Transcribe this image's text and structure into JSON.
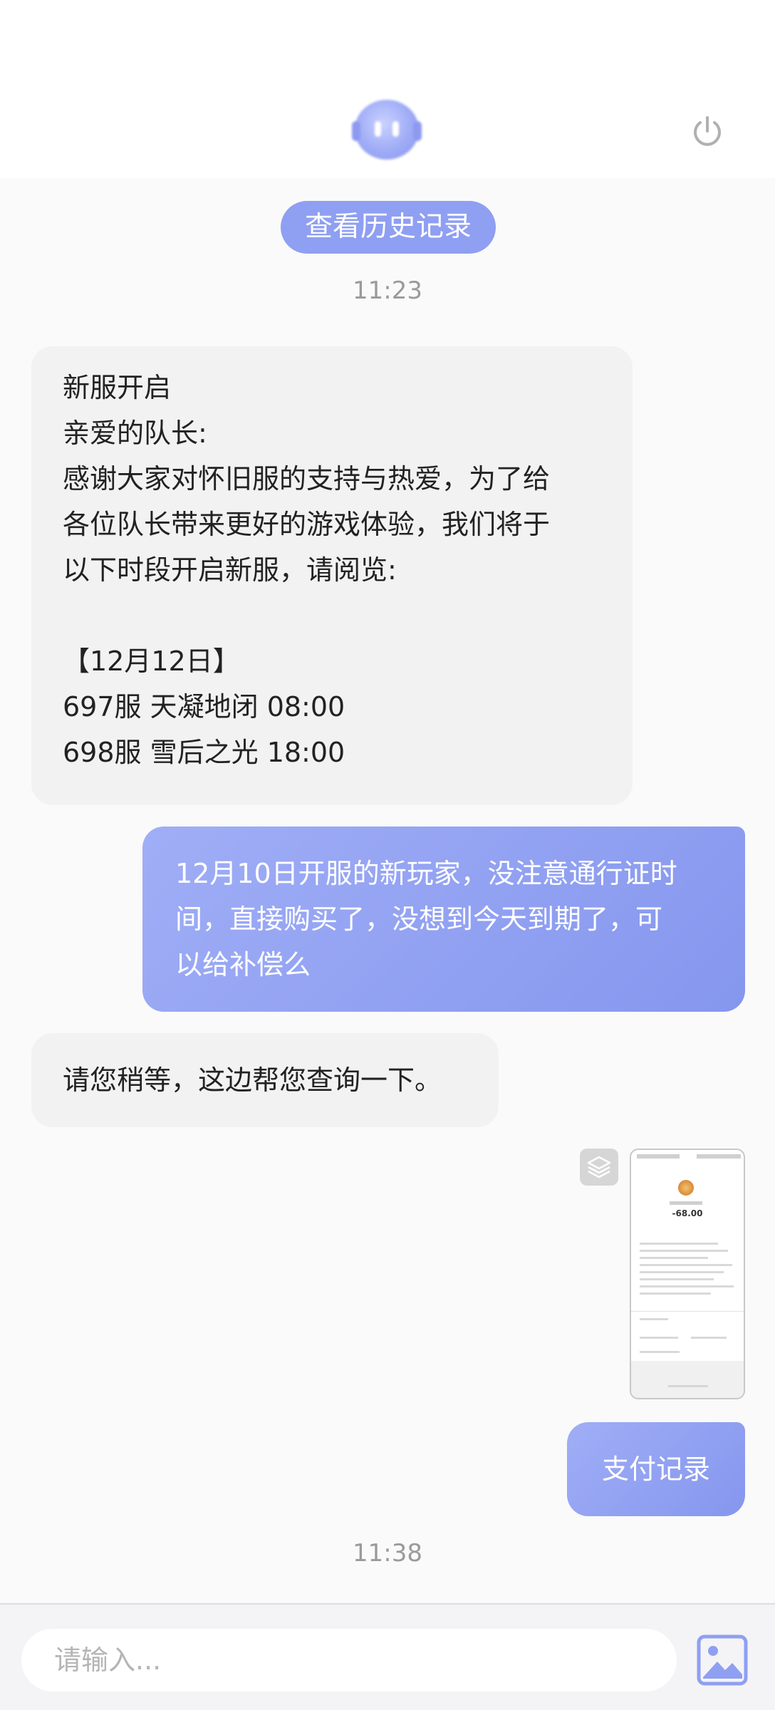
{
  "header": {
    "avatar_icon": "support-bot-avatar",
    "power_icon": "power-icon"
  },
  "history_button": {
    "label": "查看历史记录"
  },
  "messages": [
    {
      "type": "time",
      "text": "11:23"
    },
    {
      "type": "received",
      "lines": [
        "新服开启",
        "亲爱的队长:",
        "感谢大家对怀旧服的支持与热爱，为了给",
        "各位队长带来更好的游戏体验，我们将于",
        "以下时段开启新服，请阅览:",
        "",
        "【12月12日】",
        "697服 天凝地闭 08:00",
        "698服 雪后之光 18:00"
      ]
    },
    {
      "type": "sent",
      "lines": [
        "12月10日开服的新玩家，没注意通行证时",
        "间，直接购买了，没想到今天到期了，可",
        "以给补偿么"
      ]
    },
    {
      "type": "received",
      "lines": [
        "请您稍等，这边帮您查询一下。"
      ]
    },
    {
      "type": "sent-image",
      "thumb": {
        "amount": "-68.00"
      }
    },
    {
      "type": "sent",
      "lines": [
        "支付记录"
      ]
    },
    {
      "type": "time",
      "text": "11:38"
    }
  ],
  "input": {
    "placeholder": "请输入..."
  },
  "colors": {
    "accent": "#8f9ff2",
    "bubble_received": "#f2f2f2",
    "bubble_sent_start": "#a0aef6",
    "bubble_sent_end": "#8596ee"
  }
}
